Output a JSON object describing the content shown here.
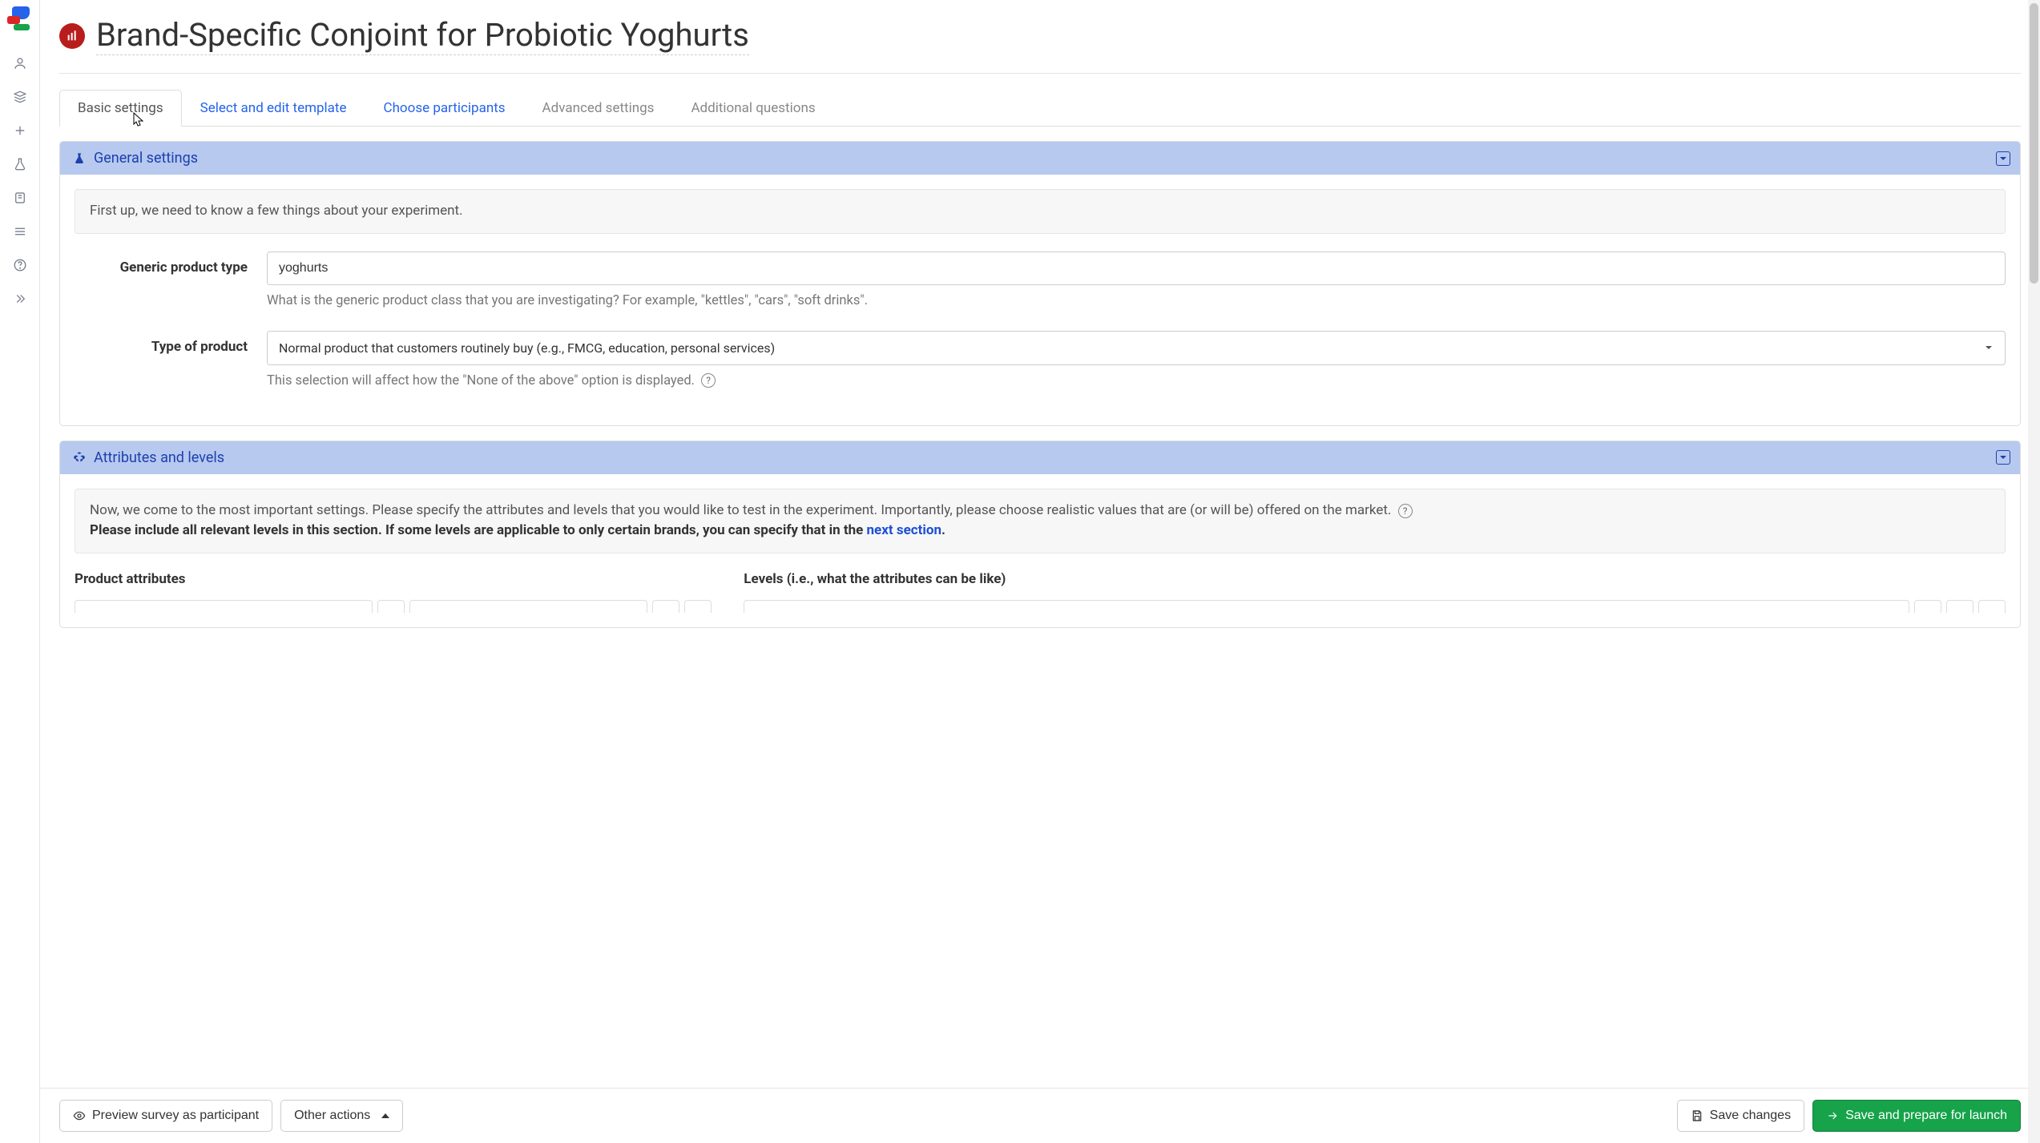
{
  "page": {
    "title": "Brand-Specific Conjoint for Probiotic Yoghurts"
  },
  "tabs": [
    {
      "label": "Basic settings",
      "state": "active"
    },
    {
      "label": "Select and edit template",
      "state": "link"
    },
    {
      "label": "Choose participants",
      "state": "link"
    },
    {
      "label": "Advanced settings",
      "state": "disabled"
    },
    {
      "label": "Additional questions",
      "state": "disabled"
    }
  ],
  "general": {
    "header": "General settings",
    "intro": "First up, we need to know a few things about your experiment.",
    "generic_label": "Generic product type",
    "generic_value": "yoghurts",
    "generic_help": "What is the generic product class that you are investigating? For example, \"kettles\", \"cars\", \"soft drinks\".",
    "type_label": "Type of product",
    "type_value": "Normal product that customers routinely buy (e.g., FMCG, education, personal services)",
    "type_help": "This selection will affect how the \"None of the above\" option is displayed."
  },
  "attributes": {
    "header": "Attributes and levels",
    "intro_a": "Now, we come to the most important settings. Please specify the attributes and levels that you would like to test in the experiment. Importantly, please choose realistic values that are (or will be) offered on the market.",
    "intro_b_prefix": "Please include all relevant levels in this section. If some levels are applicable to only certain brands, you can specify that in the ",
    "intro_b_link": "next section",
    "intro_b_suffix": ".",
    "col_attr": "Product attributes",
    "col_levels": "Levels (i.e., what the attributes can be like)"
  },
  "footer": {
    "preview": "Preview survey as participant",
    "other": "Other actions",
    "save": "Save changes",
    "launch": "Save and prepare for launch"
  }
}
